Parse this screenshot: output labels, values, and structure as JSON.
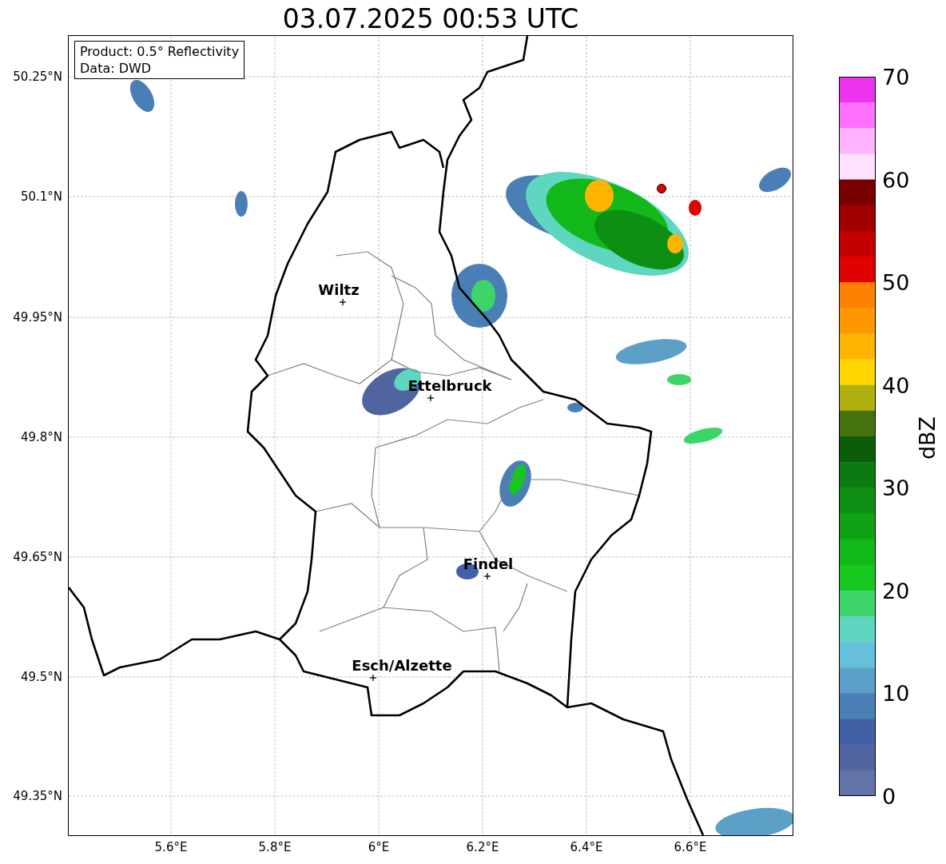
{
  "title": "03.07.2025 00:53 UTC",
  "info_box": {
    "lines": [
      "Product: 0.5° Reflectivity",
      "Data: DWD"
    ]
  },
  "y_ticks": [
    "50.25°N",
    "50.1°N",
    "49.95°N",
    "49.8°N",
    "49.65°N",
    "49.5°N",
    "49.35°N"
  ],
  "x_ticks": [
    "5.6°E",
    "5.8°E",
    "6°E",
    "6.2°E",
    "6.4°E",
    "6.6°E"
  ],
  "cities": [
    {
      "name": "Wiltz"
    },
    {
      "name": "Ettelbruck"
    },
    {
      "name": "Findel"
    },
    {
      "name": "Esch/Alzette"
    }
  ],
  "colorbar": {
    "label": "dBZ",
    "ticks": [
      "70",
      "60",
      "50",
      "40",
      "30",
      "20",
      "10",
      "0"
    ],
    "segments": [
      {
        "color": "#ee33ee"
      },
      {
        "color": "#ff70ff"
      },
      {
        "color": "#ffb3ff"
      },
      {
        "color": "#ffe0ff"
      },
      {
        "color": "#780000"
      },
      {
        "color": "#a00000"
      },
      {
        "color": "#c40000"
      },
      {
        "color": "#e00000"
      },
      {
        "color": "#ff7f00"
      },
      {
        "color": "#ff9800"
      },
      {
        "color": "#ffb400"
      },
      {
        "color": "#ffd700"
      },
      {
        "color": "#b0b010"
      },
      {
        "color": "#45720c"
      },
      {
        "color": "#0a5e0a"
      },
      {
        "color": "#0b7a10"
      },
      {
        "color": "#0e8e12"
      },
      {
        "color": "#10a215"
      },
      {
        "color": "#12b81a"
      },
      {
        "color": "#14c81e"
      },
      {
        "color": "#3dd46a"
      },
      {
        "color": "#5fd6c0"
      },
      {
        "color": "#66c0dc"
      },
      {
        "color": "#5ca0c8"
      },
      {
        "color": "#4a7fb5"
      },
      {
        "color": "#4260a5"
      },
      {
        "color": "#5064a0"
      },
      {
        "color": "#6373a8"
      }
    ]
  }
}
